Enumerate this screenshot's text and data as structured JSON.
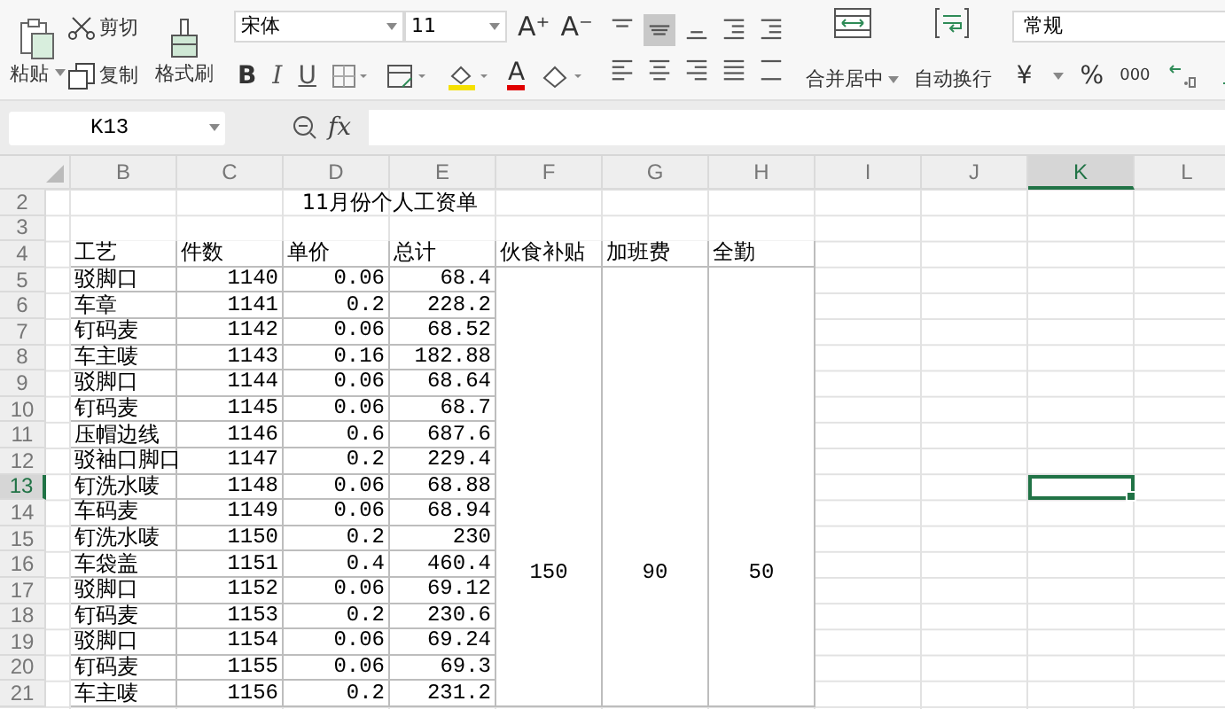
{
  "ribbon": {
    "clipboard": [
      {
        "kind": "paste",
        "label": "粘贴"
      },
      {
        "kind": "cut",
        "label": "剪切"
      },
      {
        "kind": "copy",
        "label": "复制"
      },
      {
        "kind": "painter",
        "label": "格式刷"
      }
    ],
    "font": {
      "name": "宋体",
      "size": "11",
      "grow": "A⁺",
      "shrink": "A⁻",
      "bold": "B",
      "italic": "I",
      "underline": "U",
      "text_color": "A"
    },
    "alignment": [
      {
        "kind": "top",
        "selected": false
      },
      {
        "kind": "middle",
        "selected": true
      },
      {
        "kind": "bottom",
        "selected": false
      },
      {
        "kind": "outdent",
        "selected": false
      },
      {
        "kind": "indent",
        "selected": false
      },
      {
        "kind": "left",
        "selected": false
      },
      {
        "kind": "center",
        "selected": false
      },
      {
        "kind": "right",
        "selected": false
      },
      {
        "kind": "justify",
        "selected": false
      },
      {
        "kind": "distributed",
        "selected": false
      }
    ],
    "merge": "合并居中",
    "wrap": "自动换行",
    "number_format": "常规",
    "currency": "¥",
    "percent": "%",
    "thousands": "000"
  },
  "formula_bar": {
    "cell": "K13",
    "fx": "fx"
  },
  "sheet": {
    "columns": [
      {
        "label": "B",
        "selected": false
      },
      {
        "label": "C",
        "selected": false
      },
      {
        "label": "D",
        "selected": false
      },
      {
        "label": "E",
        "selected": false
      },
      {
        "label": "F",
        "selected": false
      },
      {
        "label": "G",
        "selected": false
      },
      {
        "label": "H",
        "selected": false
      },
      {
        "label": "I",
        "selected": false
      },
      {
        "label": "J",
        "selected": false
      },
      {
        "label": "K",
        "selected": true
      },
      {
        "label": "L",
        "selected": false
      }
    ],
    "rows": [
      {
        "number": "2",
        "selected": false,
        "kind": "title",
        "cells": [
          "",
          "",
          "11月份个人工资单"
        ]
      },
      {
        "number": "3",
        "selected": false,
        "kind": "blank",
        "cells": []
      },
      {
        "number": "4",
        "selected": false,
        "kind": "header",
        "cells": [
          "工艺",
          "件数",
          "单价",
          "总计",
          "伙食补贴",
          "加班费",
          "全勤"
        ]
      },
      {
        "number": "5",
        "selected": false,
        "kind": "data",
        "cells": [
          "驳脚口",
          "1140",
          "0.06",
          "68.4"
        ]
      },
      {
        "number": "6",
        "selected": false,
        "kind": "data",
        "cells": [
          "车章",
          "1141",
          "0.2",
          "228.2"
        ]
      },
      {
        "number": "7",
        "selected": false,
        "kind": "data",
        "cells": [
          "钉码麦",
          "1142",
          "0.06",
          "68.52"
        ]
      },
      {
        "number": "8",
        "selected": false,
        "kind": "data",
        "cells": [
          "车主唛",
          "1143",
          "0.16",
          "182.88"
        ]
      },
      {
        "number": "9",
        "selected": false,
        "kind": "data",
        "cells": [
          "驳脚口",
          "1144",
          "0.06",
          "68.64"
        ]
      },
      {
        "number": "10",
        "selected": false,
        "kind": "data",
        "cells": [
          "钉码麦",
          "1145",
          "0.06",
          "68.7"
        ]
      },
      {
        "number": "11",
        "selected": false,
        "kind": "data",
        "cells": [
          "压帽边线",
          "1146",
          "0.6",
          "687.6"
        ]
      },
      {
        "number": "12",
        "selected": false,
        "kind": "data",
        "cells": [
          "驳袖口脚口",
          "1147",
          "0.2",
          "229.4"
        ]
      },
      {
        "number": "13",
        "selected": true,
        "kind": "data",
        "cells": [
          "钉洗水唛",
          "1148",
          "0.06",
          "68.88"
        ]
      },
      {
        "number": "14",
        "selected": false,
        "kind": "data",
        "cells": [
          "车码麦",
          "1149",
          "0.06",
          "68.94"
        ]
      },
      {
        "number": "15",
        "selected": false,
        "kind": "data",
        "cells": [
          "钉洗水唛",
          "1150",
          "0.2",
          "230"
        ]
      },
      {
        "number": "16",
        "selected": false,
        "kind": "data",
        "cells": [
          "车袋盖",
          "1151",
          "0.4",
          "460.4"
        ]
      },
      {
        "number": "17",
        "selected": false,
        "kind": "data",
        "cells": [
          "驳脚口",
          "1152",
          "0.06",
          "69.12"
        ]
      },
      {
        "number": "18",
        "selected": false,
        "kind": "data",
        "cells": [
          "钉码麦",
          "1153",
          "0.2",
          "230.6"
        ]
      },
      {
        "number": "19",
        "selected": false,
        "kind": "data",
        "cells": [
          "驳脚口",
          "1154",
          "0.06",
          "69.24"
        ]
      },
      {
        "number": "20",
        "selected": false,
        "kind": "data",
        "cells": [
          "钉码麦",
          "1155",
          "0.06",
          "69.3"
        ]
      },
      {
        "number": "21",
        "selected": false,
        "kind": "data",
        "cells": [
          "车主唛",
          "1156",
          "0.2",
          "231.2"
        ]
      }
    ],
    "allowances": [
      "150",
      "90",
      "50"
    ]
  }
}
